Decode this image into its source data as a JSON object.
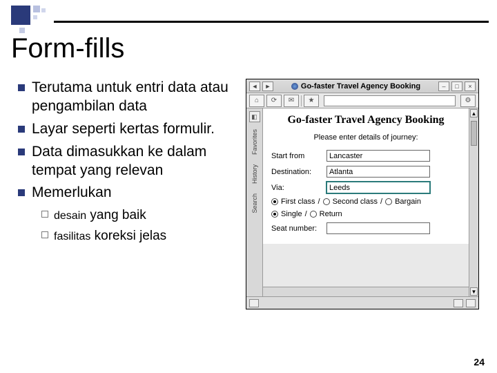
{
  "slide": {
    "title": "Form-fills",
    "page_number": "24"
  },
  "bullets": {
    "items": [
      "Terutama untuk entri data atau pengambilan data",
      "Layar seperti kertas formulir.",
      "Data dimasukkan ke dalam tempat yang relevan",
      "Memerlukan"
    ],
    "subitems": [
      {
        "lead": "desain",
        "rest": " yang baik"
      },
      {
        "lead": "fasilitas",
        "rest": " koreksi jelas"
      }
    ]
  },
  "app": {
    "window_title": "Go-faster Travel Agency Booking",
    "heading": "Go-faster Travel Agency Booking",
    "prompt": "Please enter details of journey:",
    "fields": {
      "start_from": {
        "label": "Start from",
        "value": "Lancaster"
      },
      "destination": {
        "label": "Destination:",
        "value": "Atlanta"
      },
      "via": {
        "label": "Via:",
        "value": "Leeds"
      },
      "seat_number": {
        "label": "Seat number:",
        "value": ""
      }
    },
    "class_options": {
      "first": "First class",
      "second": "Second class",
      "bargain": "Bargain",
      "sep": "/",
      "selected": "first"
    },
    "trip_options": {
      "single": "Single",
      "return": "Return",
      "sep": "/",
      "selected": "single"
    },
    "sidebar_labels": {
      "favorites": "Favorites",
      "history": "History",
      "search": "Search"
    }
  }
}
